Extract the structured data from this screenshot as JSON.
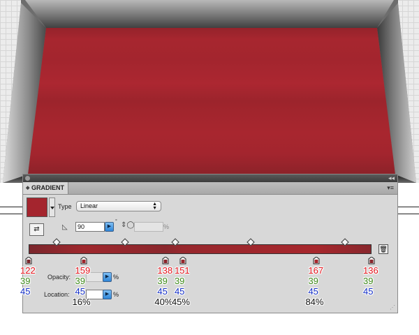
{
  "panel": {
    "tab_title": "GRADIENT",
    "type_label": "Type",
    "type_value": "Linear",
    "angle_value": "90",
    "angle_unit": "°",
    "ratio_value": "",
    "ratio_unit": "%",
    "opacity_label": "Opacity:",
    "opacity_unit": "%",
    "location_label": "Location:",
    "location_unit": "%",
    "topbar_collapse": "◂◂",
    "panel_menu": "▾≡"
  },
  "colors": {
    "artwork_red": "#a4252e",
    "frame_silver": "#8d8d8d",
    "slider_accent": "#2f86d8"
  },
  "icons": [
    "swatch-icon",
    "reverse-gradient-icon",
    "angle-icon",
    "aspect-ratio-icon",
    "trash-icon",
    "blue-arrow-icon",
    "resize-grip-icon"
  ],
  "stops": [
    {
      "location": 0,
      "r": "122",
      "g": "39",
      "b": "45",
      "location_label": ""
    },
    {
      "location": 16,
      "r": "159",
      "g": "39",
      "b": "45",
      "location_label": "16%"
    },
    {
      "location": 40,
      "r": "138",
      "g": "39",
      "b": "45",
      "location_label": "40%"
    },
    {
      "location": 45,
      "r": "151",
      "g": "39",
      "b": "45",
      "location_label": "45%"
    },
    {
      "location": 84,
      "r": "167",
      "g": "39",
      "b": "45",
      "location_label": "84%"
    },
    {
      "location": 100,
      "r": "136",
      "g": "39",
      "b": "45",
      "location_label": ""
    }
  ],
  "midpoints": [
    8,
    28,
    42.5,
    64.5,
    92
  ]
}
